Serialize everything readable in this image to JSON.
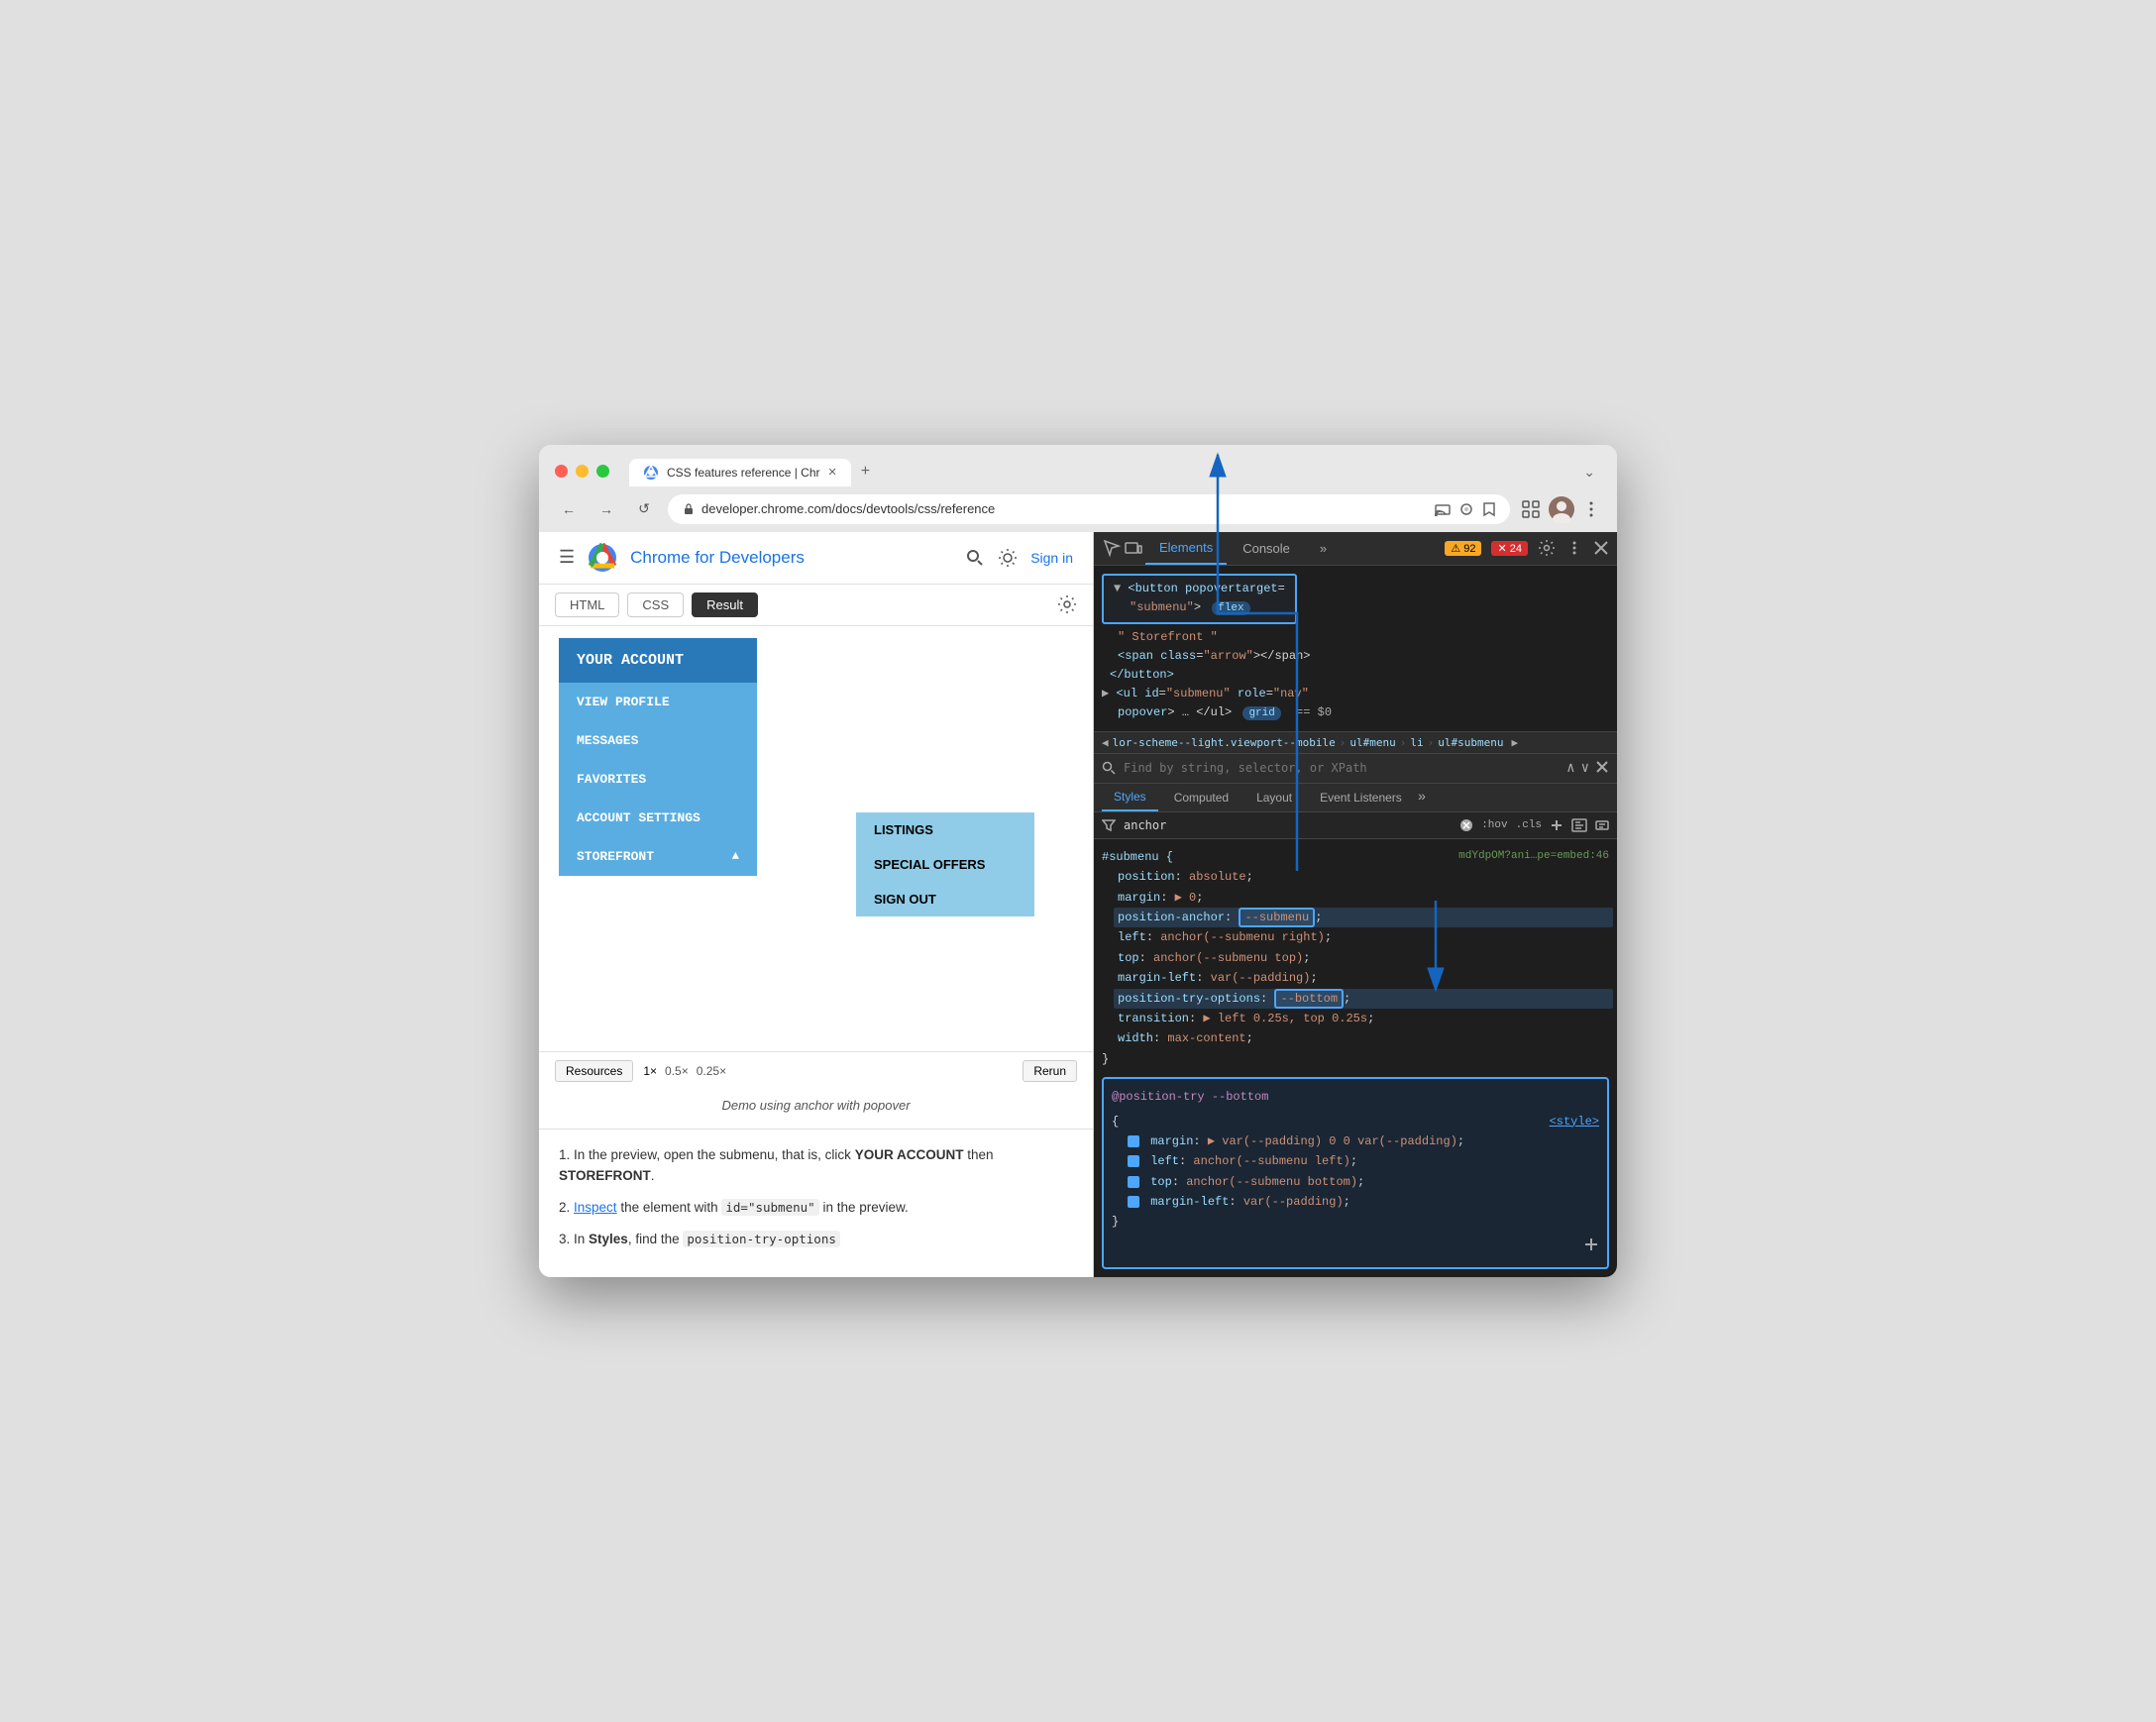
{
  "browser": {
    "title": "CSS features reference | Chr",
    "url": "developer.chrome.com/docs/devtools/css/reference",
    "tab_close": "✕",
    "tab_new": "+",
    "tab_chevron": "⌄"
  },
  "nav": {
    "back": "←",
    "forward": "→",
    "refresh": "↺"
  },
  "site": {
    "title": "Chrome for Developers",
    "sign_in": "Sign in"
  },
  "code_tabs": {
    "html": "HTML",
    "css": "CSS",
    "result": "Result"
  },
  "demo": {
    "menu_header": "YOUR ACCOUNT",
    "items": [
      "VIEW PROFILE",
      "MESSAGES",
      "FAVORITES",
      "ACCOUNT SETTINGS",
      "STOREFRONT ▲"
    ],
    "submenu_items": [
      "LISTINGS",
      "SPECIAL OFFERS",
      "SIGN OUT"
    ]
  },
  "resource_bar": {
    "resources": "Resources",
    "opt1": "1×",
    "opt2": "0.5×",
    "opt3": "0.25×",
    "rerun": "Rerun"
  },
  "demo_caption": "Demo using anchor with  popover",
  "instructions": [
    {
      "number": "1.",
      "text_before": "In the preview, open the submenu, that is, click ",
      "bold1": "YOUR ACCOUNT",
      "text_middle": " then ",
      "bold2": "STOREFRONT",
      "text_after": ".",
      "link": null
    },
    {
      "number": "2.",
      "link_text": "Inspect",
      "text_before": null,
      "text_after": " the element with ",
      "code": "id=\"submenu\"",
      "text_end": " in the preview.",
      "link": "Inspect"
    },
    {
      "number": "3.",
      "text_before": "In ",
      "bold1": "Styles",
      "text_after": ", find the ",
      "code": "position-try-options"
    }
  ],
  "devtools": {
    "tabs": [
      "Elements",
      "Console",
      "»"
    ],
    "active_tab": "Elements",
    "warning_count": "92",
    "error_count": "24"
  },
  "html_panel": {
    "button_line": "<button popovertarget=",
    "button_line2": "\"submenu\">",
    "flex_badge": "flex",
    "storefront_text": "\" Storefront \"",
    "span_line": "<span class=\"arrow\"></span>",
    "button_close": "</button>",
    "ul_line": "▶ <ul id=\"submenu\" role=\"nav\"",
    "popover_line": "popover> … </ul>",
    "grid_badge": "grid",
    "dollar": "== $0"
  },
  "breadcrumbs": [
    "lor-scheme--light.viewport--mobile",
    "ul#menu",
    "li",
    "ul#submenu"
  ],
  "search": {
    "placeholder": "Find by string, selector, or XPath"
  },
  "styles_tabs": [
    "Styles",
    "Computed",
    "Layout",
    "Event Listeners",
    "»"
  ],
  "filter": {
    "placeholder": "anchor"
  },
  "css_rule": {
    "selector": "#submenu {",
    "source": "mdYdpOM?ani…pe=embed:46",
    "props": [
      {
        "prop": "position",
        "val": "absolute"
      },
      {
        "prop": "margin",
        "val": "▶ 0"
      },
      {
        "prop": "position-anchor",
        "val": "--submenu",
        "highlighted": true
      },
      {
        "prop": "left",
        "val": "anchor(--submenu right)"
      },
      {
        "prop": "top",
        "val": "anchor(--submenu top)"
      },
      {
        "prop": "margin-left",
        "val": "var(--padding)"
      },
      {
        "prop": "position-try-options",
        "val": "--bottom",
        "highlighted": true
      },
      {
        "prop": "transition",
        "val": "▶ left 0.25s, top 0.25s"
      },
      {
        "prop": "width",
        "val": "max-content"
      }
    ]
  },
  "position_try": {
    "header": "@position-try --bottom",
    "open": "{",
    "source": "<style>",
    "props": [
      {
        "prop": "margin",
        "val": "▶ var(--padding) 0 0 var(--padding)"
      },
      {
        "prop": "left",
        "val": "anchor(--submenu left)"
      },
      {
        "prop": "top",
        "val": "anchor(--submenu bottom)"
      },
      {
        "prop": "margin-left",
        "val": "var(--padding)"
      }
    ],
    "close": "}"
  }
}
